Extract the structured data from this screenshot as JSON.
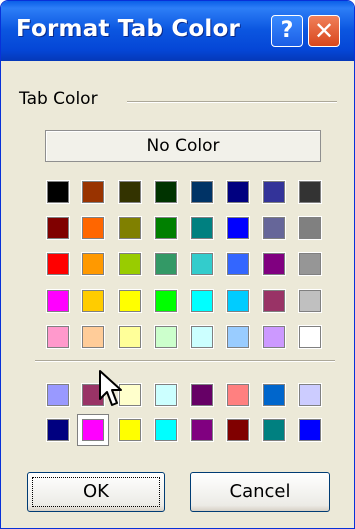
{
  "window": {
    "title": "Format Tab Color",
    "help_label": "?",
    "close_label": "✕"
  },
  "group": {
    "label": "Tab Color"
  },
  "no_color_label": "No Color",
  "palette": [
    [
      "#000000",
      "#993300",
      "#333300",
      "#003300",
      "#003366",
      "#000080",
      "#333399",
      "#333333"
    ],
    [
      "#800000",
      "#ff6600",
      "#808000",
      "#008000",
      "#008080",
      "#0000ff",
      "#666699",
      "#808080"
    ],
    [
      "#ff0000",
      "#ff9900",
      "#99cc00",
      "#339966",
      "#33cccc",
      "#3366ff",
      "#800080",
      "#969696"
    ],
    [
      "#ff00ff",
      "#ffcc00",
      "#ffff00",
      "#00ff00",
      "#00ffff",
      "#00ccff",
      "#993366",
      "#c0c0c0"
    ],
    [
      "#ff99cc",
      "#ffcc99",
      "#ffff99",
      "#ccffcc",
      "#ccffff",
      "#99ccff",
      "#cc99ff",
      "#ffffff"
    ]
  ],
  "extra_palette": [
    [
      "#9999ff",
      "#993366",
      "#ffffcc",
      "#ccffff",
      "#660066",
      "#ff8080",
      "#0066cc",
      "#ccccff"
    ],
    [
      "#000080",
      "#ff00ff",
      "#ffff00",
      "#00ffff",
      "#800080",
      "#800000",
      "#008080",
      "#0000ff"
    ]
  ],
  "selected": {
    "palette": "extra_palette",
    "row": 1,
    "col": 1
  },
  "buttons": {
    "ok_label": "OK",
    "cancel_label": "Cancel"
  },
  "icons": {
    "help": "help-icon",
    "close": "close-icon",
    "cursor": "mouse-pointer-icon"
  }
}
